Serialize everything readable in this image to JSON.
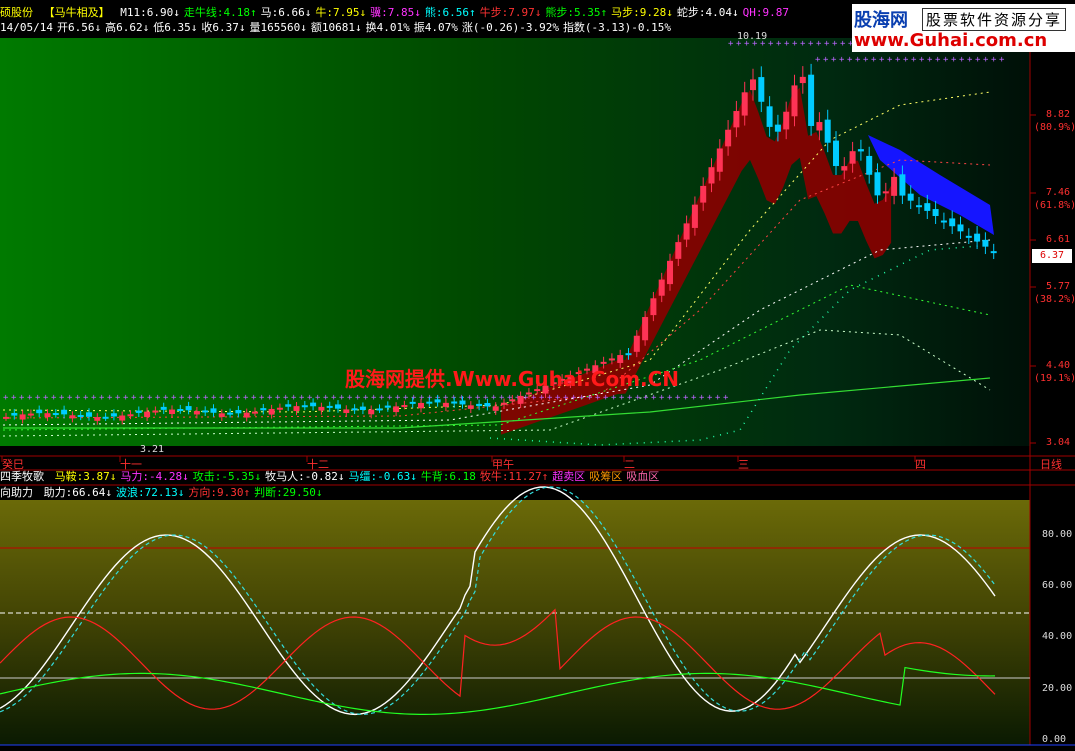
{
  "header": {
    "stock_name": "硕股份",
    "formula_name": "【马牛相及】",
    "items": [
      {
        "text": "M11:6.90↓",
        "color": "#ffffff"
      },
      {
        "text": "走牛线:4.18↑",
        "color": "#00ff00"
      },
      {
        "text": "马:6.66↓",
        "color": "#ffffff"
      },
      {
        "text": "牛:7.95↓",
        "color": "#ffff00"
      },
      {
        "text": "骥:7.85↓",
        "color": "#ff33ff"
      },
      {
        "text": "熊:6.56↑",
        "color": "#00ffff"
      },
      {
        "text": "牛步:7.97↓",
        "color": "#ff3333"
      },
      {
        "text": "熊步:5.35↑",
        "color": "#00ff00"
      },
      {
        "text": "马步:9.28↓",
        "color": "#ffff00"
      },
      {
        "text": "蛇步:4.04↓",
        "color": "#ffffff"
      },
      {
        "text": "QH:9.87",
        "color": "#ff33ff"
      }
    ]
  },
  "quote_line": {
    "items": [
      {
        "text": "14/05/14",
        "color": "#ffffff"
      },
      {
        "text": "开6.56↓",
        "color": "#ffffff"
      },
      {
        "text": "高6.62↓",
        "color": "#ffffff"
      },
      {
        "text": "低6.35↓",
        "color": "#ffffff"
      },
      {
        "text": "收6.37↓",
        "color": "#ffffff"
      },
      {
        "text": "量165560↓",
        "color": "#ffffff"
      },
      {
        "text": "额10681↓",
        "color": "#ffffff"
      },
      {
        "text": "换4.01%",
        "color": "#ffffff"
      },
      {
        "text": "振4.07%",
        "color": "#ffffff"
      },
      {
        "text": "涨(-0.26)-3.92%",
        "color": "#ffffff"
      },
      {
        "text": "指数(-3.13)-0.15%",
        "color": "#ffffff"
      }
    ]
  },
  "logo": {
    "line1": "股海网",
    "line2": "股票软件资源分享",
    "line3": "www.Guhai.com.cn"
  },
  "watermark": "股海网提供.Www.Guhai.Com.CN",
  "price_axis": {
    "ticks": [
      {
        "value": "8.82",
        "pct": "(80.9%)"
      },
      {
        "value": "7.46",
        "pct": "(61.8%)"
      },
      {
        "value": "6.61",
        "pct": ""
      },
      {
        "value": "5.77",
        "pct": "(38.2%)"
      },
      {
        "value": "4.40",
        "pct": "(19.1%)"
      },
      {
        "value": "3.04",
        "pct": ""
      }
    ],
    "current_price": "6.37"
  },
  "annotations": {
    "high": "10.19",
    "low": "3.21"
  },
  "time_axis": {
    "labels": [
      "癸巳",
      "十一",
      "十二",
      "甲午",
      "二",
      "三",
      "四"
    ],
    "period": "日线"
  },
  "indicator1": {
    "name": "四季牧歌",
    "items": [
      {
        "text": "马鞍:3.87↓",
        "color": "#ffff00"
      },
      {
        "text": "马力:-4.28↓",
        "color": "#ff33ff"
      },
      {
        "text": "攻击:-5.35↓",
        "color": "#00ff00"
      },
      {
        "text": "牧马人:-0.82↓",
        "color": "#ffffff"
      },
      {
        "text": "马缰:-0.63↓",
        "color": "#00ffff"
      },
      {
        "text": "牛背:6.18",
        "color": "#00ff00"
      },
      {
        "text": "牧牛:11.27↑",
        "color": "#ff3333"
      },
      {
        "text": "超卖区",
        "color": "#ff33ff"
      },
      {
        "text": "吸筹区",
        "color": "#ff9900"
      },
      {
        "text": "吸血区",
        "color": "#ff66aa"
      }
    ]
  },
  "indicator2": {
    "name": "向助力",
    "items": [
      {
        "text": "助力:66.64↓",
        "color": "#ffffff"
      },
      {
        "text": "波浪:72.13↓",
        "color": "#00ffff"
      },
      {
        "text": "方向:9.30↑",
        "color": "#ff3333"
      },
      {
        "text": "判断:29.50↓",
        "color": "#00ff00"
      }
    ]
  },
  "osc_axis": {
    "ticks": [
      "80.00",
      "60.00",
      "40.00",
      "20.00",
      "0.00"
    ]
  },
  "colors": {
    "up_candle": "#ff3355",
    "down_candle": "#00ccff",
    "band_red": "#8b0000",
    "band_blue": "#1515ff",
    "grid": "#a00000"
  }
}
